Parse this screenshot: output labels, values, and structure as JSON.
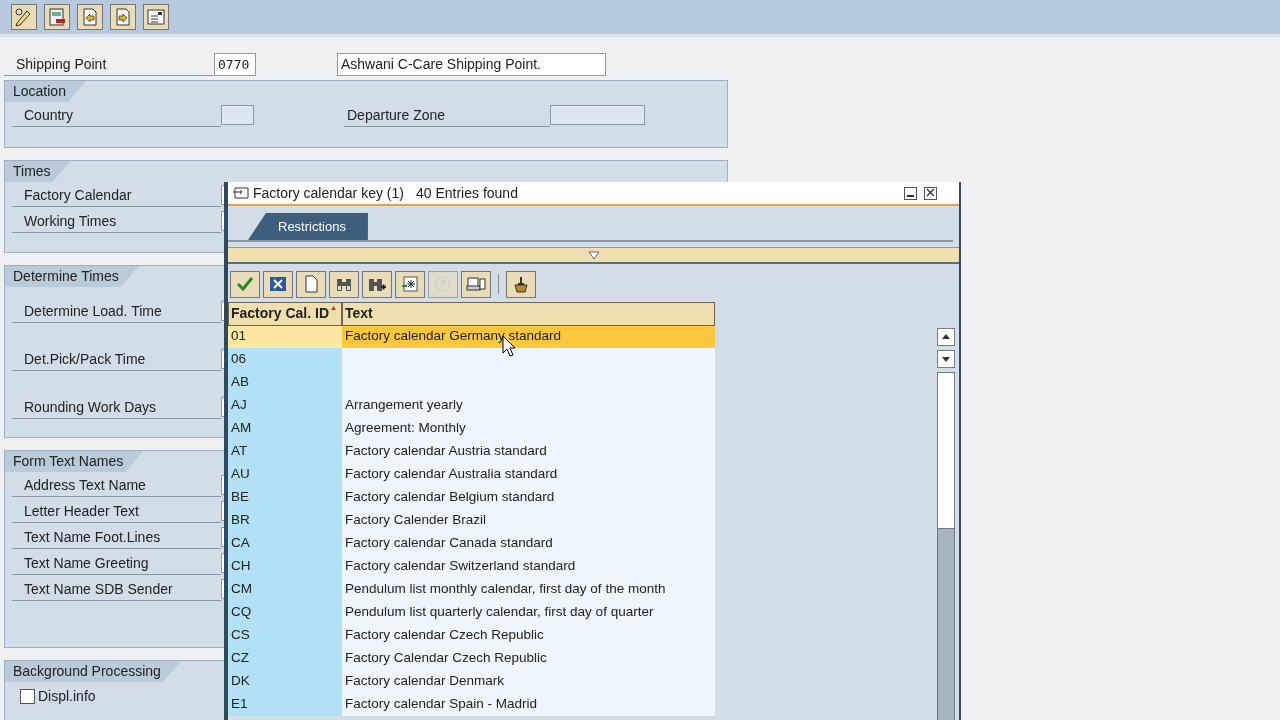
{
  "header": {
    "shipping_point": {
      "label": "Shipping Point",
      "value": "0770",
      "description": "Ashwani C-Care Shipping Point."
    }
  },
  "groups": [
    {
      "title": "Location",
      "fields": [
        {
          "label": "Country"
        }
      ],
      "side_field": {
        "label": "Departure Zone"
      }
    },
    {
      "title": "Times",
      "fields": [
        {
          "label": "Factory Calendar"
        },
        {
          "label": "Working Times"
        }
      ]
    },
    {
      "title": "Determine Times",
      "fields": [
        {
          "label": "Determine Load. Time"
        },
        {
          "label": "Det.Pick/Pack Time"
        },
        {
          "label": "Rounding Work Days"
        }
      ]
    },
    {
      "title": "Form Text Names",
      "fields": [
        {
          "label": "Address Text Name"
        },
        {
          "label": "Letter Header Text"
        },
        {
          "label": "Text Name Foot.Lines"
        },
        {
          "label": "Text Name Greeting"
        },
        {
          "label": "Text Name SDB Sender"
        }
      ]
    },
    {
      "title": "Background Processing",
      "checkbox": {
        "label": "Displ.info",
        "checked": false
      }
    }
  ],
  "dialog": {
    "title": "Factory calendar key (1)",
    "count": "40 Entries found",
    "tabs": [
      {
        "label": "Restrictions",
        "selected": true
      }
    ],
    "toolbar": [
      {
        "disabled": false
      },
      {
        "disabled": false
      },
      {
        "disabled": false
      },
      {
        "disabled": false
      },
      {
        "disabled": false
      },
      {
        "disabled": false
      },
      {
        "disabled": true
      },
      {
        "disabled": false
      },
      {
        "disabled": false
      }
    ],
    "columns": [
      "Factory Cal. ID",
      "Text"
    ],
    "rows": [
      {
        "id": "01",
        "text": "Factory calendar Germany standard",
        "selected": true
      },
      {
        "id": "06",
        "text": "",
        "selected": false
      },
      {
        "id": "AB",
        "text": "",
        "selected": false
      },
      {
        "id": "AJ",
        "text": "Arrangement yearly",
        "selected": false
      },
      {
        "id": "AM",
        "text": "Agreement: Monthly",
        "selected": false
      },
      {
        "id": "AT",
        "text": "Factory calendar Austria standard",
        "selected": false
      },
      {
        "id": "AU",
        "text": "Factory calendar Australia standard",
        "selected": false
      },
      {
        "id": "BE",
        "text": "Factory calendar Belgium standard",
        "selected": false
      },
      {
        "id": "BR",
        "text": "Factory Calender Brazil",
        "selected": false
      },
      {
        "id": "CA",
        "text": "Factory calendar Canada standard",
        "selected": false
      },
      {
        "id": "CH",
        "text": "Factory calendar Switzerland standard",
        "selected": false
      },
      {
        "id": "CM",
        "text": "Pendulum list monthly calendar, first day of the month",
        "selected": false
      },
      {
        "id": "CQ",
        "text": "Pendulum list quarterly calendar, first day of quarter",
        "selected": false
      },
      {
        "id": "CS",
        "text": "Factory calendar Czech Republic",
        "selected": false
      },
      {
        "id": "CZ",
        "text": "Factory Calendar Czech Republic",
        "selected": false
      },
      {
        "id": "DK",
        "text": "Factory calendar Denmark",
        "selected": false
      },
      {
        "id": "E1",
        "text": "Factory calendar Spain - Madrid",
        "selected": false
      }
    ]
  }
}
